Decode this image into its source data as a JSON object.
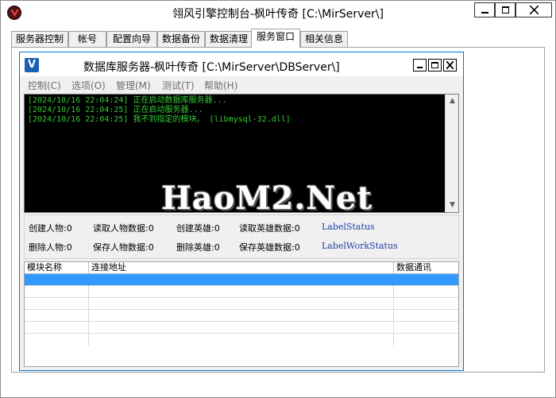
{
  "window": {
    "title": "翎风引擎控制台-枫叶传奇 [C:\\MirServer\\]"
  },
  "tabs": [
    {
      "label": "服务器控制"
    },
    {
      "label": "帐号"
    },
    {
      "label": "配置向导"
    },
    {
      "label": "数据备份"
    },
    {
      "label": "数据清理"
    },
    {
      "label": "服务窗口"
    },
    {
      "label": "相关信息"
    }
  ],
  "active_tab": "服务窗口",
  "child_window": {
    "icon_letter": "V",
    "title": "数据库服务器-枫叶传奇  [C:\\MirServer\\DBServer\\]",
    "menu": [
      {
        "label": "控制(C)"
      },
      {
        "label": "选项(O)"
      },
      {
        "label": "管理(M)"
      },
      {
        "label": "测试(T)"
      },
      {
        "label": "帮助(H)"
      }
    ],
    "log_lines": [
      "[2024/10/16 22:04:24] 正在启动数据库服务器...",
      "[2024/10/16 22:04:25] 正在启动服务器...",
      "[2024/10/16 22:04:25] 我不到指定的模块。 [libmysql-32.dll]"
    ],
    "watermark": "HaoM2.Net",
    "stats": {
      "create_char": "创建人物:0",
      "read_char": "读取人物数据:0",
      "create_hero": "创建英雄:0",
      "read_hero": "读取英雄数据:0",
      "label_status": "LabelStatus",
      "delete_char": "删除人物:0",
      "save_char": "保存人物数据:0",
      "delete_hero": "删除英雄:0",
      "save_hero": "保存英雄数据:0",
      "label_work_status": "LabelWorkStatus"
    },
    "table": {
      "columns": [
        "模块名称",
        "连接地址",
        "数据通讯"
      ],
      "rows": [
        [
          "",
          "",
          ""
        ],
        [
          "",
          "",
          ""
        ],
        [
          "",
          "",
          ""
        ],
        [
          "",
          "",
          ""
        ],
        [
          "",
          "",
          ""
        ],
        [
          "",
          "",
          ""
        ]
      ],
      "selected_row": 0
    }
  },
  "colors": {
    "log_text": "#33cc33",
    "log_bg": "#000000",
    "selection": "#3399ff",
    "status_label": "#1e3fa8"
  }
}
